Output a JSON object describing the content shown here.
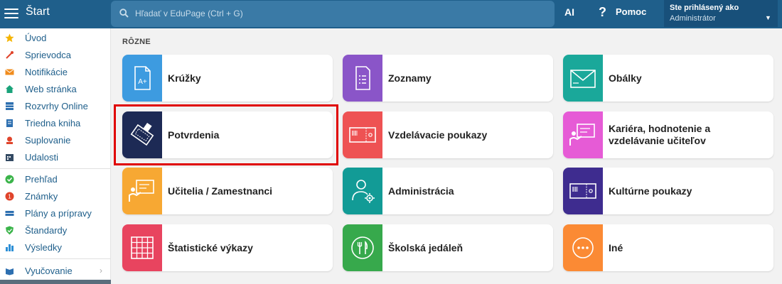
{
  "header": {
    "title": "Štart",
    "search_placeholder": "Hľadať v EduPage (Ctrl + G)",
    "ai_label": "AI",
    "help_label": "Pomoc",
    "user_status": "Ste prihlásený ako",
    "user_role": "Administrátor"
  },
  "sidebar": {
    "items": [
      {
        "label": "Úvod",
        "icon": "star-icon",
        "color": "#f5b400"
      },
      {
        "label": "Sprievodca",
        "icon": "magic-wand-icon",
        "color": "#e0442b"
      },
      {
        "label": "Notifikácie",
        "icon": "envelope-icon",
        "color": "#f08c1e"
      },
      {
        "label": "Web stránka",
        "icon": "house-icon",
        "color": "#1aa37a"
      },
      {
        "label": "Rozvrhy Online",
        "icon": "timetable-icon",
        "color": "#2d6fb0"
      },
      {
        "label": "Triedna kniha",
        "icon": "book-icon",
        "color": "#2d6fb0"
      },
      {
        "label": "Suplovanie",
        "icon": "substitution-icon",
        "color": "#e0442b"
      },
      {
        "label": "Udalosti",
        "icon": "calendar-icon",
        "color": "#334a63"
      },
      {
        "label": "Prehľad",
        "icon": "check-circle-icon",
        "color": "#3bb44a"
      },
      {
        "label": "Známky",
        "icon": "grade-icon",
        "color": "#e0442b"
      },
      {
        "label": "Plány a prípravy",
        "icon": "plans-icon",
        "color": "#2d6fb0"
      },
      {
        "label": "Štandardy",
        "icon": "shield-icon",
        "color": "#3bb44a"
      },
      {
        "label": "Výsledky",
        "icon": "bar-chart-icon",
        "color": "#2d8fd6"
      },
      {
        "label": "Vyučovanie",
        "icon": "teaching-icon",
        "color": "#2d6fb0"
      }
    ]
  },
  "main": {
    "section_title": "RÔZNE",
    "tiles": [
      {
        "label": "Krúžky",
        "color": "#3d9be0",
        "icon": "grade-document-icon"
      },
      {
        "label": "Zoznamy",
        "color": "#8a55c8",
        "icon": "list-document-icon"
      },
      {
        "label": "Obálky",
        "color": "#1aa89a",
        "icon": "envelope-icon"
      },
      {
        "label": "Potvrdenia",
        "color": "#1d2a55",
        "icon": "stamp-icon"
      },
      {
        "label": "Vzdelávacie poukazy",
        "color": "#ee5253",
        "icon": "voucher-icon"
      },
      {
        "label": "Kariéra, hodnotenie a vzdelávanie učiteľov",
        "color": "#e65bd6",
        "icon": "teacher-board-icon"
      },
      {
        "label": "Učitelia / Zamestnanci",
        "color": "#f7a833",
        "icon": "teacher-board-icon"
      },
      {
        "label": "Administrácia",
        "color": "#129b96",
        "icon": "admin-gear-icon"
      },
      {
        "label": "Kultúrne poukazy",
        "color": "#3e2c8f",
        "icon": "voucher-icon"
      },
      {
        "label": "Štatistické výkazy",
        "color": "#e8445f",
        "icon": "grid-table-icon"
      },
      {
        "label": "Školská jedáleň",
        "color": "#37a94c",
        "icon": "cutlery-icon"
      },
      {
        "label": "Iné",
        "color": "#fb8a34",
        "icon": "more-dots-icon"
      }
    ]
  }
}
